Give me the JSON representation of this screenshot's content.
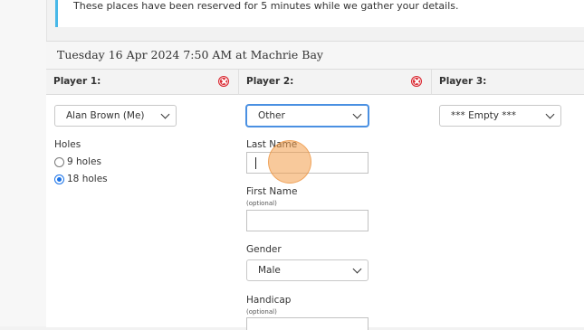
{
  "notice": {
    "text": "These places have been reserved for 5 minutes while we gather your details."
  },
  "booking": {
    "title": "Tuesday 16 Apr 2024 7:50 AM at Machrie Bay"
  },
  "players": [
    {
      "header": "Player 1:",
      "selected": "Alan Brown (Me)",
      "removable": true
    },
    {
      "header": "Player 2:",
      "selected": "Other",
      "removable": true
    },
    {
      "header": "Player 3:",
      "selected": "*** Empty ***",
      "removable": false
    }
  ],
  "holes": {
    "label": "Holes",
    "options": [
      {
        "label": "9 holes",
        "selected": false
      },
      {
        "label": "18 holes",
        "selected": true
      }
    ]
  },
  "player2_form": {
    "last_name_label": "Last Name",
    "last_name_value": "",
    "first_name_label": "First Name",
    "first_name_hint": "(optional)",
    "first_name_value": "",
    "gender_label": "Gender",
    "gender_value": "Male",
    "handicap_label": "Handicap",
    "handicap_hint": "(optional)"
  },
  "colors": {
    "accent": "#48b8e8",
    "remove": "#d9262f",
    "focus": "#4a90e2",
    "click_marker": "#f39c48"
  }
}
